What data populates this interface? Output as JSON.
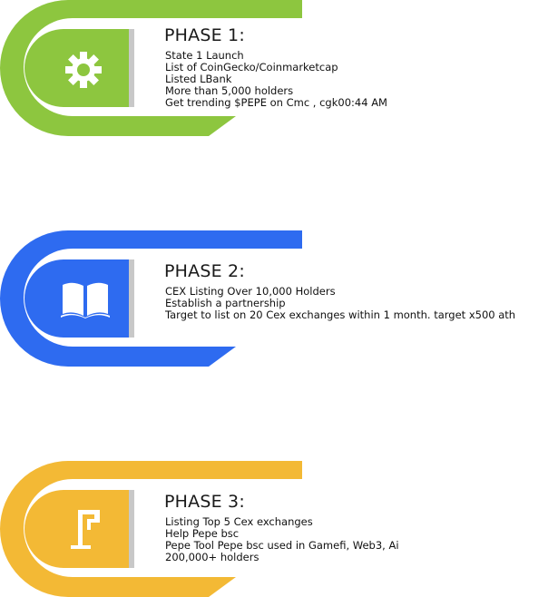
{
  "colors": {
    "green": "#8dc63f",
    "blue": "#2e6bf0",
    "yellow": "#f3b935",
    "bar": "#c8c8c8"
  },
  "phases": [
    {
      "icon": "gear-icon",
      "color": "#8dc63f",
      "title": "PHASE 1:",
      "lines": [
        "State 1 Launch",
        "List of CoinGecko/Coinmarketcap",
        "Listed LBank",
        "More than 5,000 holders",
        "Get trending $PEPE on Cmc , cgk00:44 AM"
      ]
    },
    {
      "icon": "book-icon",
      "color": "#2e6bf0",
      "title": "PHASE 2:",
      "lines": [
        "CEX Listing Over 10,000 Holders",
        "Establish a partnership",
        "Target to list on 20 Cex exchanges within 1 month. target x500 ath"
      ]
    },
    {
      "icon": "flag-icon",
      "color": "#f3b935",
      "title": "PHASE 3:",
      "lines": [
        "Listing Top 5 Cex exchanges",
        "Help Pepe bsc",
        "Pepe Tool Pepe bsc used in Gamefi, Web3, Ai",
        "200,000+ holders"
      ]
    }
  ]
}
